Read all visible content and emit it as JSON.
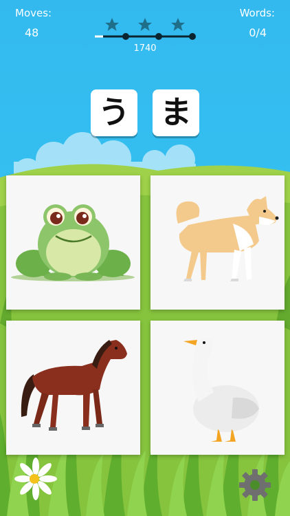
{
  "hud": {
    "moves_label": "Moves:",
    "moves_value": "48",
    "words_label": "Words:",
    "words_value": "0/4",
    "score": "1740",
    "stars_earned": 3,
    "stars_total": 3
  },
  "word_tiles": [
    "う",
    "ま"
  ],
  "cards": [
    {
      "animal": "frog",
      "icon": "frog-picture"
    },
    {
      "animal": "dog",
      "icon": "dog-picture"
    },
    {
      "animal": "horse",
      "icon": "horse-picture"
    },
    {
      "animal": "goose",
      "icon": "goose-picture"
    }
  ],
  "colors": {
    "sky": "#35c0f1",
    "grass": "#7cc242",
    "card_bg": "#f7f7f7",
    "star": "#1f6f8b"
  }
}
